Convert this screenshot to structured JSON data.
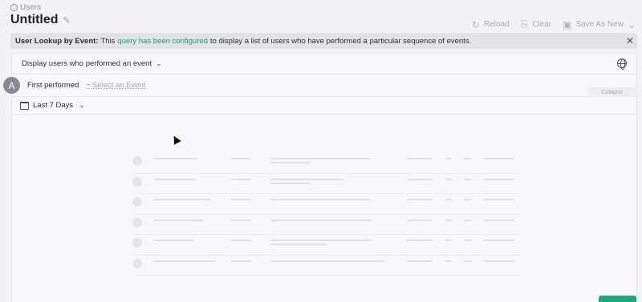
{
  "breadcrumb": {
    "label": "Users"
  },
  "page": {
    "title": "Untitled"
  },
  "toolbar": {
    "reload": "Reload",
    "clear": "Clear",
    "save_as_new": "Save As New"
  },
  "banner": {
    "bold": "User Lookup by Event:",
    "pre": "This",
    "link": "query has been configured",
    "post": "to display a list of users who have performed a particular sequence of events."
  },
  "query": {
    "display_mode": "Display users who performed an event",
    "step_letter": "A",
    "step_label": "First performed",
    "select_event": "Select an Event",
    "collapse": "Collapse",
    "date_range": "Last 7 Days"
  },
  "skeleton_rows": 6,
  "colors": {
    "accent": "#1f9d6e",
    "primary_button": "#1fa67a"
  },
  "icons": [
    "users-icon",
    "pencil-icon",
    "reload-icon",
    "clear-icon",
    "save-icon",
    "close-icon",
    "chevron-down-icon",
    "globe-icon",
    "calendar-icon"
  ]
}
